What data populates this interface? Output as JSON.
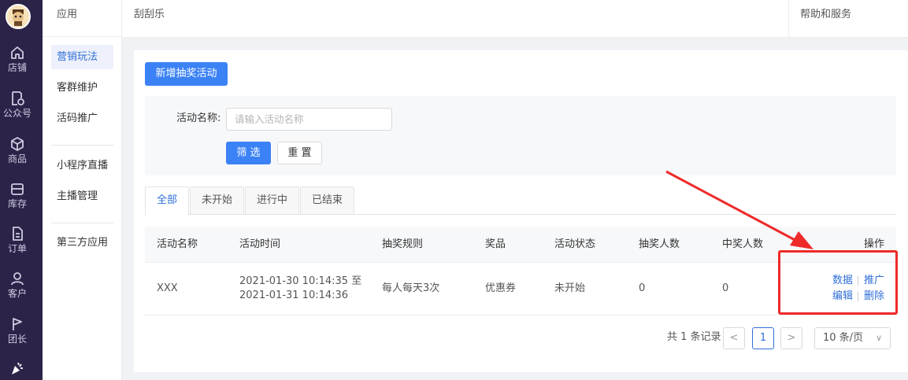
{
  "nav": {
    "items": [
      {
        "label": "店铺",
        "icon": "home-icon"
      },
      {
        "label": "公众号",
        "icon": "document-badge-icon"
      },
      {
        "label": "商品",
        "icon": "box-icon"
      },
      {
        "label": "库存",
        "icon": "inventory-icon"
      },
      {
        "label": "订单",
        "icon": "order-icon"
      },
      {
        "label": "客户",
        "icon": "user-icon"
      },
      {
        "label": "团长",
        "icon": "flag-icon"
      },
      {
        "label": "",
        "icon": "party-popper-icon"
      }
    ]
  },
  "sidebar": {
    "header": "应用",
    "items": [
      "营销玩法",
      "客群维护",
      "活码推广",
      "小程序直播",
      "主播管理",
      "第三方应用"
    ],
    "active_index": 0
  },
  "topbar": {
    "title": "刮刮乐",
    "help": "帮助和服务"
  },
  "main": {
    "add_button": "新增抽奖活动",
    "filter": {
      "label": "活动名称:",
      "placeholder": "请输入活动名称",
      "value": "",
      "filter_button": "筛 选",
      "reset_button": "重 置"
    },
    "tabs": [
      "全部",
      "未开始",
      "进行中",
      "已结束"
    ],
    "active_tab": 0,
    "table": {
      "columns": [
        "活动名称",
        "活动时间",
        "抽奖规则",
        "奖品",
        "活动状态",
        "抽奖人数",
        "中奖人数",
        "操作"
      ],
      "rows": [
        {
          "name": "XXX",
          "time_start": "2021-01-30 10:14:35 至",
          "time_end": "2021-01-31 10:14:36",
          "rule": "每人每天3次",
          "prize": "优惠券",
          "status": "未开始",
          "draw_count": "0",
          "win_count": "0",
          "actions": [
            "数据",
            "推广",
            "编辑",
            "删除"
          ]
        }
      ]
    },
    "pagination": {
      "total_text": "共 1 条记录",
      "prev": "<",
      "current_page": "1",
      "next": ">",
      "page_size": "10 条/页"
    }
  },
  "colors": {
    "nav_bg": "#2b2348",
    "primary": "#3b82f6",
    "link": "#2f6fd8",
    "annotation": "#ee2a2a"
  }
}
